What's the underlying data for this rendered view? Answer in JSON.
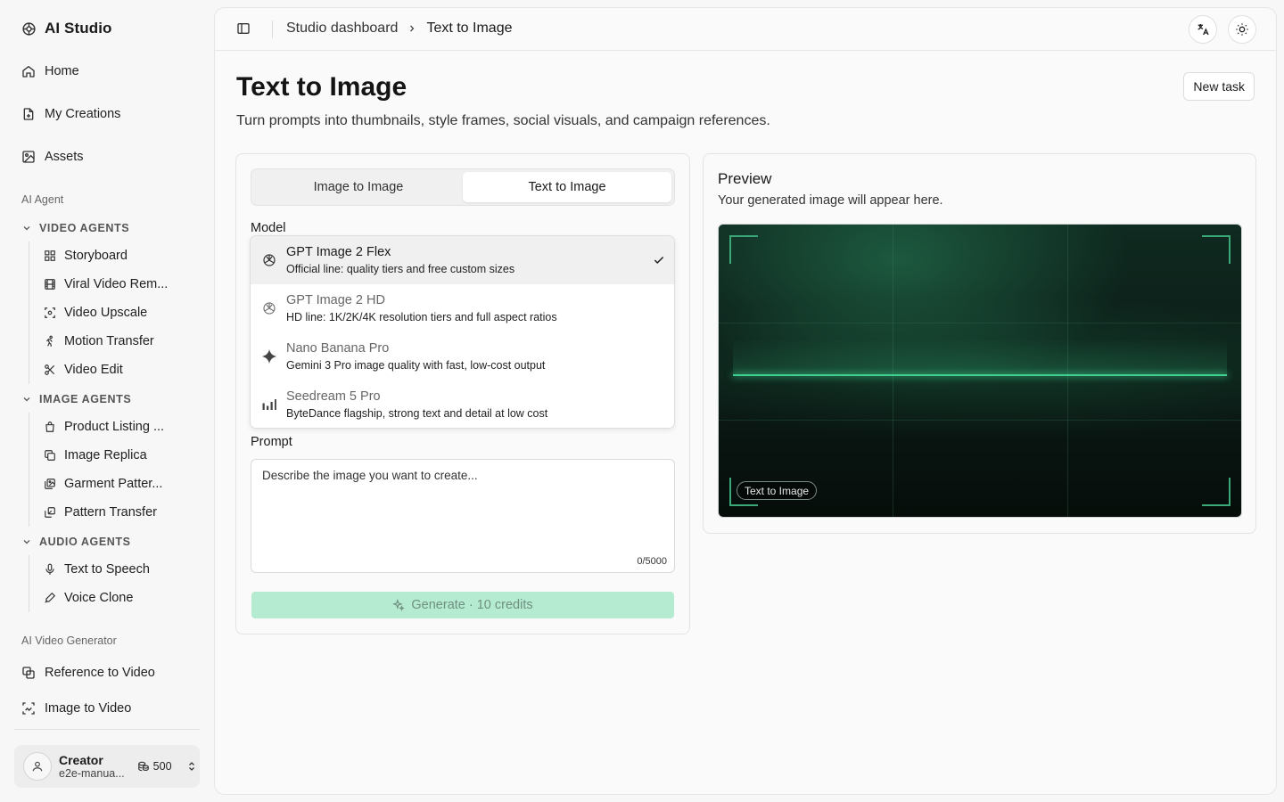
{
  "app": {
    "title": "AI Studio"
  },
  "sidebar": {
    "top_items": [
      {
        "label": "Home",
        "icon": "home-icon"
      },
      {
        "label": "My Creations",
        "icon": "file-icon"
      },
      {
        "label": "Assets",
        "icon": "image-icon"
      }
    ],
    "section_ai_agent": "AI Agent",
    "video_agents": {
      "title": "VIDEO AGENTS",
      "items": [
        "Storyboard",
        "Viral Video Rem...",
        "Video Upscale",
        "Motion Transfer",
        "Video Edit"
      ]
    },
    "image_agents": {
      "title": "IMAGE AGENTS",
      "items": [
        "Product Listing ...",
        "Image Replica",
        "Garment Patter...",
        "Pattern Transfer"
      ]
    },
    "audio_agents": {
      "title": "AUDIO AGENTS",
      "items": [
        "Text to Speech",
        "Voice Clone"
      ]
    },
    "section_video_gen": "AI Video Generator",
    "bottom_items": [
      {
        "label": "Reference to Video",
        "icon": "reference-icon"
      },
      {
        "label": "Image to Video",
        "icon": "scan-icon"
      }
    ],
    "user": {
      "name": "Creator",
      "email": "e2e-manua...",
      "credits": "500"
    }
  },
  "topbar": {
    "breadcrumb_parent": "Studio dashboard",
    "breadcrumb_current": "Text to Image"
  },
  "page": {
    "title": "Text to Image",
    "subtitle": "Turn prompts into thumbnails, style frames, social visuals, and campaign references.",
    "new_task_label": "New task"
  },
  "form": {
    "tabs": [
      "Image to Image",
      "Text to Image"
    ],
    "active_tab": "Text to Image",
    "model_label": "Model",
    "models": [
      {
        "name": "GPT Image 2 Flex",
        "desc": "Official line: quality tiers and free custom sizes",
        "icon": "openai-icon",
        "selected": true
      },
      {
        "name": "GPT Image 2 HD",
        "desc": "HD line: 1K/2K/4K resolution tiers and full aspect ratios",
        "icon": "openai-icon",
        "selected": false
      },
      {
        "name": "Nano Banana Pro",
        "desc": "Gemini 3 Pro image quality with fast, low-cost output",
        "icon": "sparkle-icon",
        "selected": false
      },
      {
        "name": "Seedream 5 Pro",
        "desc": "ByteDance flagship, strong text and detail at low cost",
        "icon": "bars-icon",
        "selected": false
      }
    ],
    "prompt_label": "Prompt",
    "prompt_placeholder": "Describe the image you want to create...",
    "prompt_value": "",
    "char_count": "0/5000",
    "generate_label": "Generate · 10 credits"
  },
  "preview": {
    "title": "Preview",
    "subtitle": "Your generated image will appear here.",
    "badge": "Text to Image"
  },
  "colors": {
    "accent": "#3fcf8e",
    "generate_disabled_bg": "#b5ecd1",
    "preview_bg": "#0b1a15"
  }
}
